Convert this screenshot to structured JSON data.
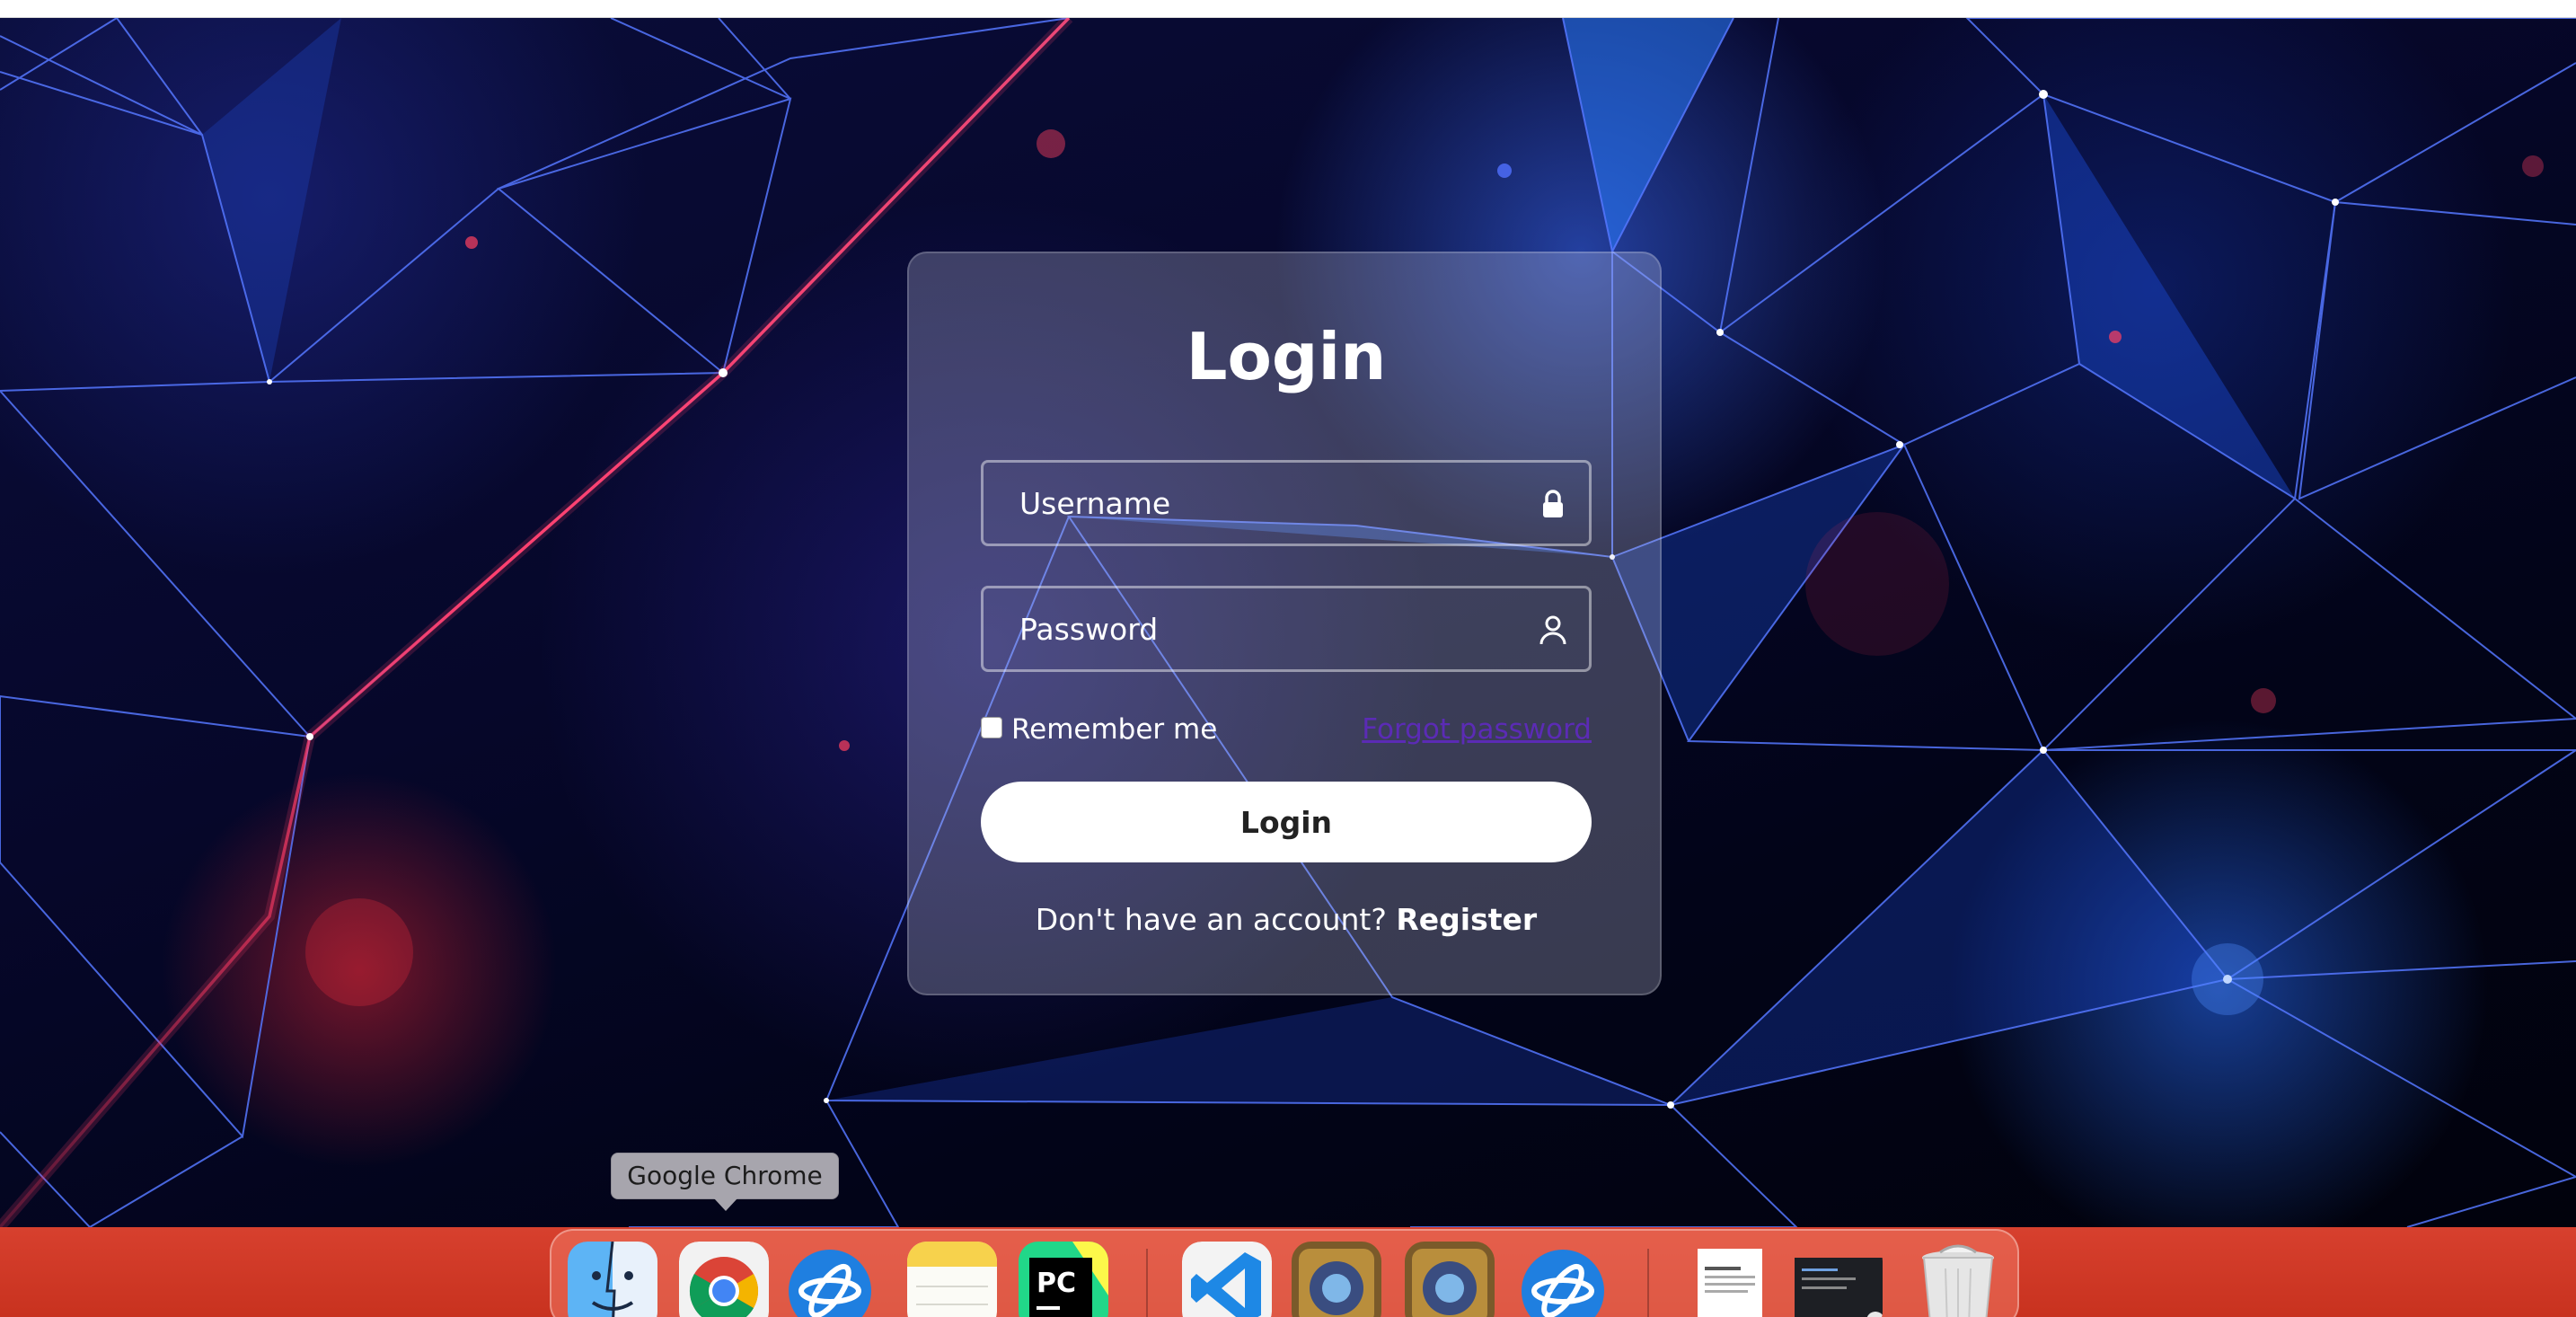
{
  "login": {
    "title": "Login",
    "username_placeholder": "Username",
    "password_placeholder": "Password",
    "remember_label": "Remember me",
    "forgot_label": "Forgot password",
    "button_label": "Login",
    "register_prompt": "Don't have an account?",
    "register_label": "Register"
  },
  "dock": {
    "tooltip": "Google Chrome",
    "items": [
      {
        "name": "finder-icon"
      },
      {
        "name": "google-chrome-icon"
      },
      {
        "name": "battle-net-icon"
      },
      {
        "name": "notes-icon"
      },
      {
        "name": "pycharm-icon"
      },
      {
        "name": "vscode-icon"
      },
      {
        "name": "hearthstone-icon"
      },
      {
        "name": "hearthstone-icon"
      },
      {
        "name": "battle-net-icon"
      },
      {
        "name": "document-thumbnail-icon"
      },
      {
        "name": "terminal-window-thumbnail-icon"
      },
      {
        "name": "trash-icon"
      }
    ]
  },
  "colors": {
    "accent_link": "#5b2bb5",
    "dock": "#d7402e",
    "background": "#06072a"
  }
}
